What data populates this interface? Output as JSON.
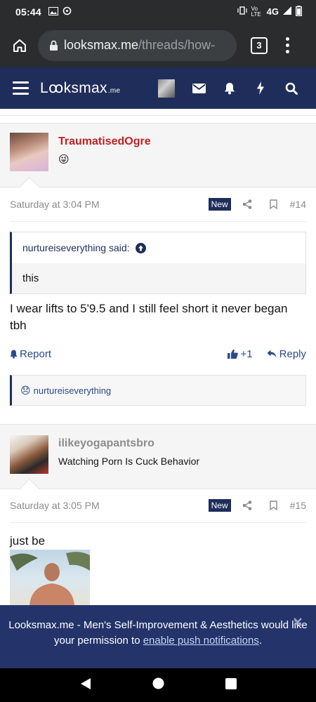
{
  "status_bar": {
    "time": "05:44",
    "network": "4G",
    "volte": "Vo LTE"
  },
  "browser": {
    "url_domain": "looksmax.me",
    "url_path": "/threads/how-",
    "tab_count": "3"
  },
  "site": {
    "logo_main": "Lꝏksmax",
    "logo_suffix": ".me"
  },
  "posts": [
    {
      "username": "TraumatisedOgre",
      "user_title_emoji": "😜",
      "date": "Saturday at 3:04 PM",
      "badge": "New",
      "number": "#14",
      "quote_author": "nurtureiseverything said:",
      "quote_text": "this",
      "body": "I wear lifts to 5'9.5 and I still feel short it never began tbh",
      "report_label": "Report",
      "like_count": "+1",
      "reply_label": "Reply",
      "reaction_emoji": "😞",
      "reaction_user": "nurtureiseverything"
    },
    {
      "username": "ilikeyogapantsbro",
      "user_title": "Watching Porn Is Cuck Behavior",
      "date": "Saturday at 3:05 PM",
      "badge": "New",
      "number": "#15",
      "body": "just be"
    }
  ],
  "push_banner": {
    "text": "Looksmax.me - Men's Self-Improvement & Aesthetics would like your permission to",
    "link": "enable push notifications",
    "suffix": "."
  },
  "colors": {
    "header_bg": "#1f2d5a",
    "username_red": "#c21f1f",
    "username_gray": "#8c8c8c",
    "link_blue": "#2b4a8c"
  }
}
